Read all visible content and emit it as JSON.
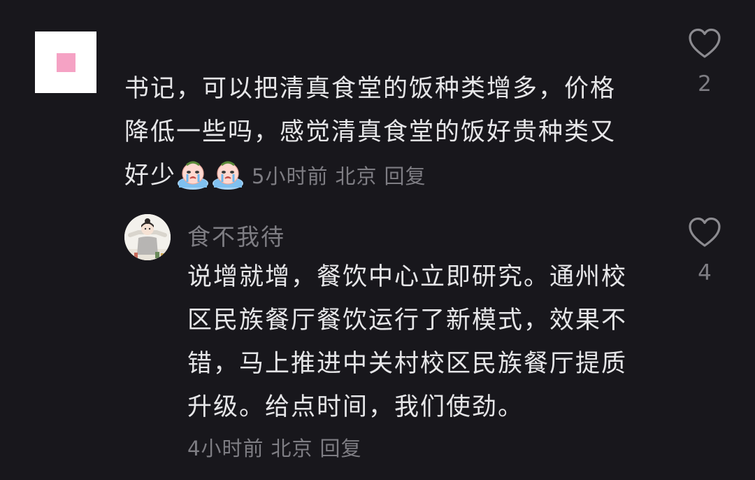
{
  "comment": {
    "lines": [
      "书记，可以把清真食堂的饭种类增多，价格",
      "降低一些吗，感觉清真食堂的饭好贵种类又",
      "好少"
    ],
    "emoji_icon": "crying-emoji-icon",
    "time": "5小时前",
    "location": "北京",
    "reply_label": "回复",
    "like_count": "2"
  },
  "reply": {
    "author": "食不我待",
    "lines": [
      "说增就增，餐饮中心立即研究。通州校",
      "区民族餐厅餐饮运行了新模式，效果不",
      "错，马上推进中关村校区民族餐厅提质",
      "升级。给点时间，我们使劲。"
    ],
    "time": "4小时前",
    "location": "北京",
    "reply_label": "回复",
    "like_count": "4"
  },
  "colors": {
    "background": "#18171c",
    "text_primary": "#e6e6e8",
    "text_secondary": "#7e7d83",
    "avatar_accent": "#f5a2c4"
  }
}
